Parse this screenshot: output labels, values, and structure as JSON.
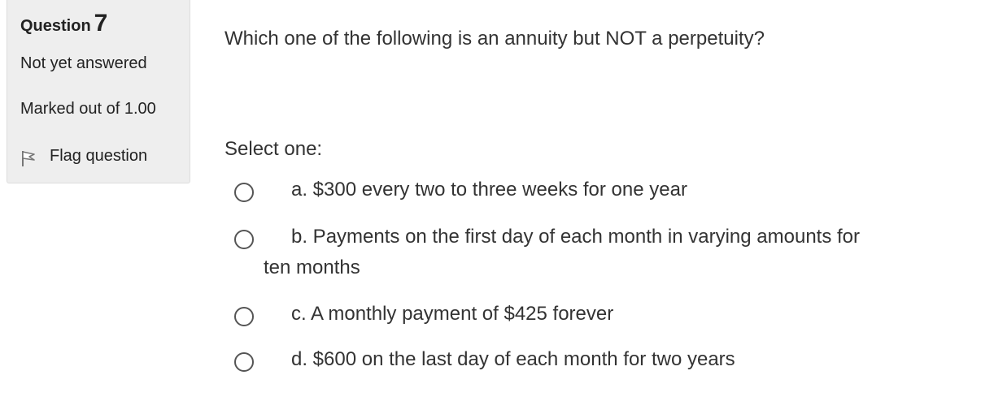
{
  "question_info": {
    "heading_label": "Question",
    "number": "7",
    "state": "Not yet answered",
    "grade": "Marked out of 1.00",
    "flag_label": "Flag question"
  },
  "question": {
    "text": "Which one of the following is an annuity but NOT a perpetuity?",
    "prompt": "Select one:",
    "options": [
      {
        "label": "a. $300 every two to three weeks for one year",
        "selected": false
      },
      {
        "label_line1": "b. Payments on the first day of each month in varying amounts for",
        "label_line2": "ten months",
        "selected": false
      },
      {
        "label": "c. A monthly payment of $425 forever",
        "selected": false
      },
      {
        "label": "d. $600 on the last day of each month for two years",
        "selected": false
      }
    ]
  },
  "colors": {
    "panel_background": "#eeeeee",
    "panel_border": "#dddddd",
    "text": "#333333"
  },
  "icons": {
    "flag": "flag-icon",
    "radio": "radio-button"
  }
}
